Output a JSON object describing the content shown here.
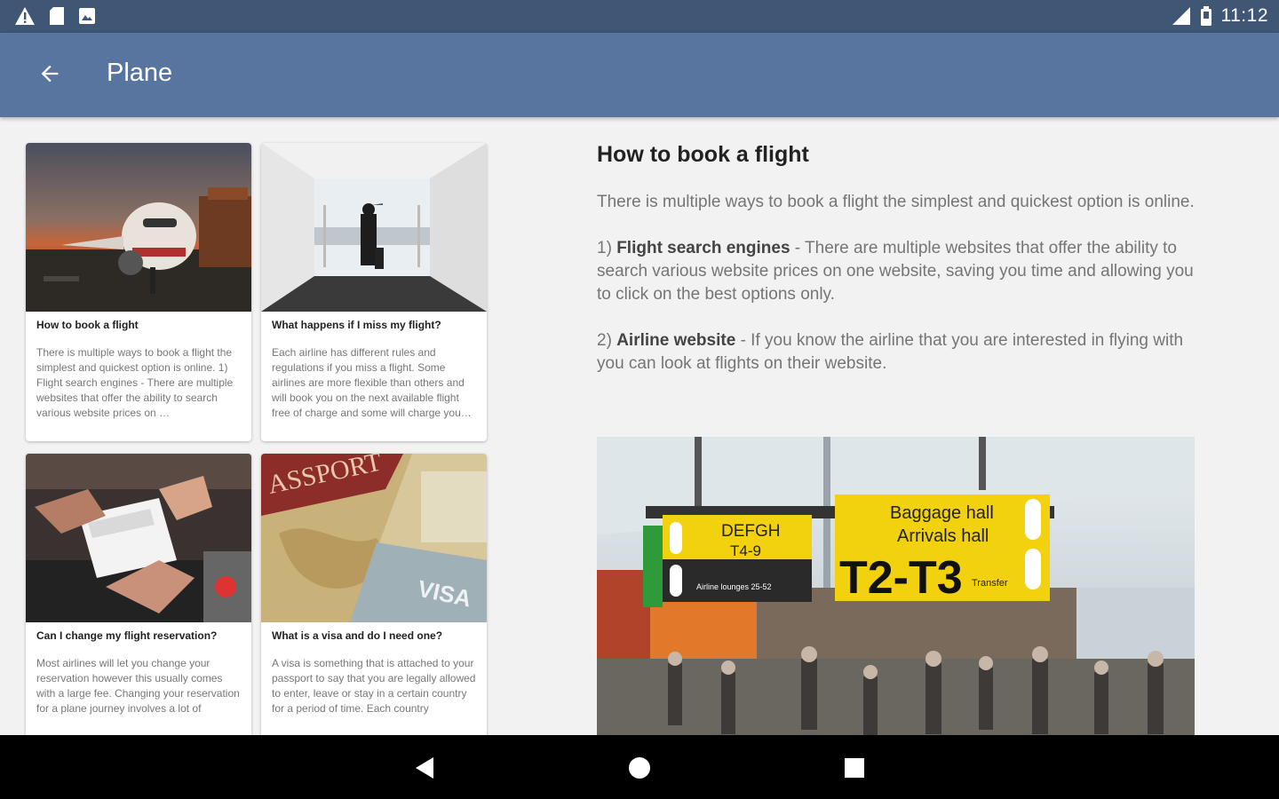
{
  "status_bar": {
    "time": "11:12",
    "left_icons": [
      "warning-icon",
      "sd-card-icon",
      "gallery-icon"
    ],
    "right_icons": [
      "signal-icon",
      "battery-icon"
    ]
  },
  "app_bar": {
    "title": "Plane",
    "back_icon": "arrow-back-icon"
  },
  "cards": [
    {
      "title": "How to book a flight",
      "description": "There is multiple ways to book a flight the simplest and quickest option is online. 1) Flight search engines - There are multiple websites that offer the ability to search various website prices on …"
    },
    {
      "title": "What happens if I miss my flight?",
      "description": "Each airline has different rules and regulations if you miss a flight. Some airlines are more flexible than others and will book you on the next available flight free of charge and some will charge you for the c…"
    },
    {
      "title": "Can I change my flight reservation?",
      "description": "Most airlines will let you change your reservation however this usually comes with a large fee. Changing your reservation for a plane journey involves a lot of"
    },
    {
      "title": "What is a visa and do I need one?",
      "description": "A visa is something that is attached to your passport to say that you are legally allowed to enter, leave or stay in a certain country for a period of time. Each country"
    }
  ],
  "detail": {
    "title": "How to book a flight",
    "intro": "There is multiple ways to book a flight the simplest and quickest option is online.",
    "point1_label": "Flight search engines",
    "point1_prefix": "1) ",
    "point1_text": " - There are multiple websites that offer the ability to search various website prices on one website, saving you time and allowing you to click on the best options only.",
    "point2_prefix": "2) ",
    "point2_label": "Airline website",
    "point2_text": " - If you know the airline that you are interested in flying with you can look at flights on their website.",
    "sign": {
      "gates": "DEFGH",
      "transfer": "T4-9",
      "baggage": "Baggage hall",
      "arrivals": "Arrivals hall",
      "terminals": "T2-T3",
      "transfer_small": "Transfer",
      "lounges": "Airline lounges 25-52"
    }
  },
  "nav_bar": {
    "back_icon": "nav-back-icon",
    "home_icon": "nav-home-icon",
    "recents_icon": "nav-recents-icon"
  }
}
